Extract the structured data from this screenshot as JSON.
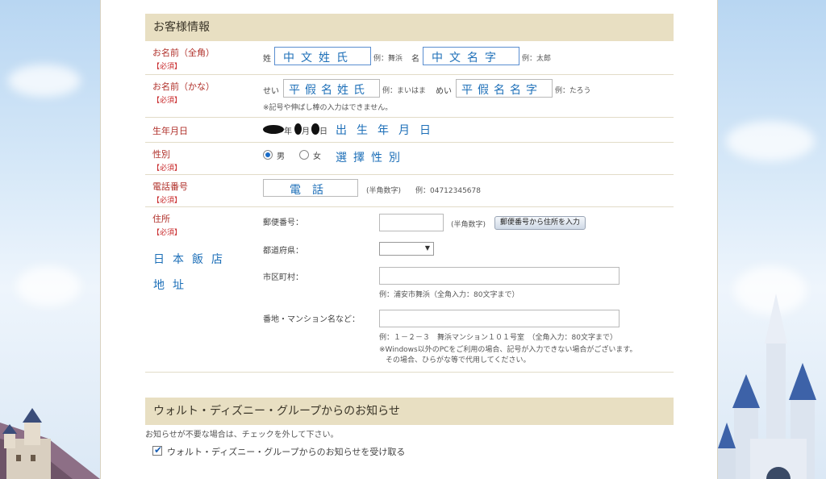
{
  "customer_section": {
    "title": "お客様情報"
  },
  "name_kanji": {
    "label": "お名前（全角）",
    "required": "【必須】",
    "sei_label": "姓",
    "sei_value": "中文姓氏",
    "sei_example": "例：舞浜",
    "mei_label": "名",
    "mei_value": "中文名字",
    "mei_example": "例：太郎"
  },
  "name_kana": {
    "label": "お名前（かな）",
    "required": "【必須】",
    "sei_label": "せい",
    "sei_value": "平假名姓氏",
    "sei_example": "例：まいはま",
    "mei_label": "めい",
    "mei_value": "平假名名字",
    "mei_example": "例：たろう",
    "note": "※記号や伸ばし棒の入力はできません。"
  },
  "birthday": {
    "label": "生年月日",
    "year_unit": "年",
    "month_unit": "月",
    "day_unit": "日",
    "annotation": "出生年月日"
  },
  "gender": {
    "label": "性別",
    "required": "【必須】",
    "male": "男",
    "female": "女",
    "selected": "男",
    "annotation": "選擇性別"
  },
  "phone": {
    "label": "電話番号",
    "required": "【必須】",
    "value": "電話",
    "hint": "(半角数字)",
    "example": "例：04712345678"
  },
  "address": {
    "label": "住所",
    "required": "【必須】",
    "annotation_line1": "日本飯店",
    "annotation_line2": "地址",
    "postal_label": "郵便番号：",
    "postal_hint": "(半角数字)",
    "postal_button": "郵便番号から住所を入力",
    "pref_label": "都道府県：",
    "pref_value": "",
    "city_label": "市区町村：",
    "city_example": "例：浦安市舞浜（全角入力：80文字まで）",
    "street_label": "番地・マンション名など：",
    "street_example": "例：１－２－３　舞浜マンション１０１号室　（全角入力：80文字まで）",
    "windows_note_1": "※Windows以外のPCをご利用の場合、記号が入力できない場合がございます。",
    "windows_note_2": "その場合、ひらがな等で代用してください。"
  },
  "notice_section": {
    "title": "ウォルト・ディズニー・グループからのお知らせ",
    "description": "お知らせが不要な場合は、チェックを外して下さい。",
    "checkbox_label": "ウォルト・ディズニー・グループからのお知らせを受け取る",
    "checked": true
  },
  "colors": {
    "header_bg": "#e8dfc2",
    "label_red": "#b0302a",
    "annotation_blue": "#1d6fb8"
  }
}
